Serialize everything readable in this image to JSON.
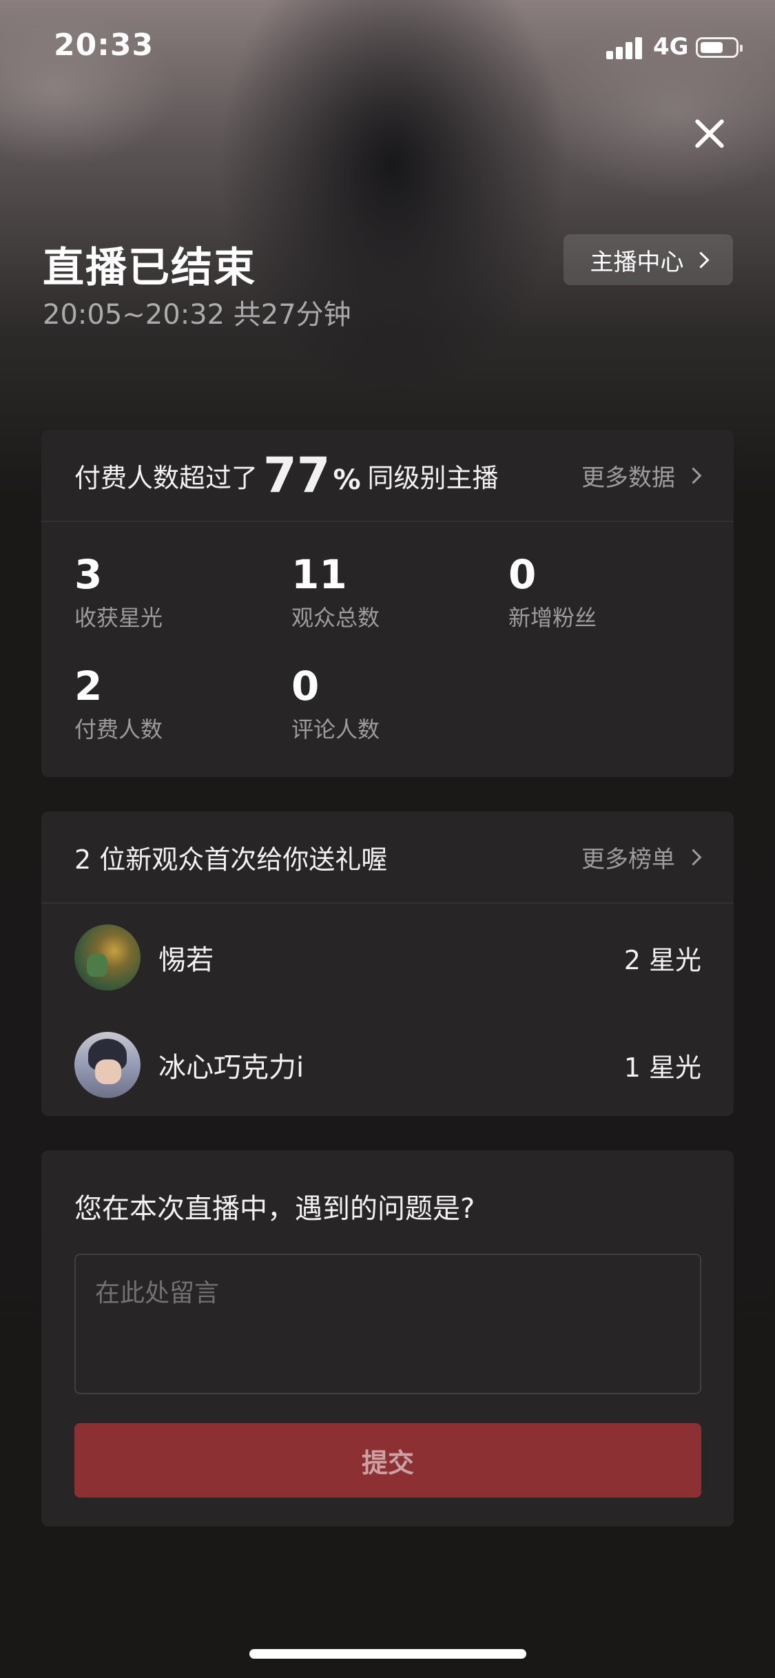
{
  "status_bar": {
    "time": "20:33",
    "network": "4G"
  },
  "header": {
    "title": "直播已结束",
    "subtitle": "20:05~20:32 共27分钟",
    "center_button": "主播中心"
  },
  "stats_card": {
    "headline_prefix": "付费人数超过了",
    "headline_value": "77",
    "headline_unit": "%",
    "headline_suffix": "同级别主播",
    "more_link": "更多数据",
    "stats": [
      {
        "value": "3",
        "label": "收获星光"
      },
      {
        "value": "11",
        "label": "观众总数"
      },
      {
        "value": "0",
        "label": "新增粉丝"
      },
      {
        "value": "2",
        "label": "付费人数"
      },
      {
        "value": "0",
        "label": "评论人数"
      }
    ]
  },
  "gift_card": {
    "headline": "2 位新观众首次给你送礼喔",
    "more_link": "更多榜单",
    "gifters": [
      {
        "name": "惕若",
        "amount": "2 星光",
        "avatar_icon": "user-avatar-icon"
      },
      {
        "name": "冰心巧克力i",
        "amount": "1 星光",
        "avatar_icon": "user-avatar-icon"
      }
    ]
  },
  "feedback_card": {
    "question": "您在本次直播中，遇到的问题是?",
    "placeholder": "在此处留言",
    "value": "",
    "submit_label": "提交"
  },
  "colors": {
    "background": "#1a1717",
    "card": "#272526",
    "submit_button": "#8c3034"
  },
  "icons": [
    "signal-icon",
    "battery-icon",
    "close-icon",
    "chevron-right-icon"
  ]
}
